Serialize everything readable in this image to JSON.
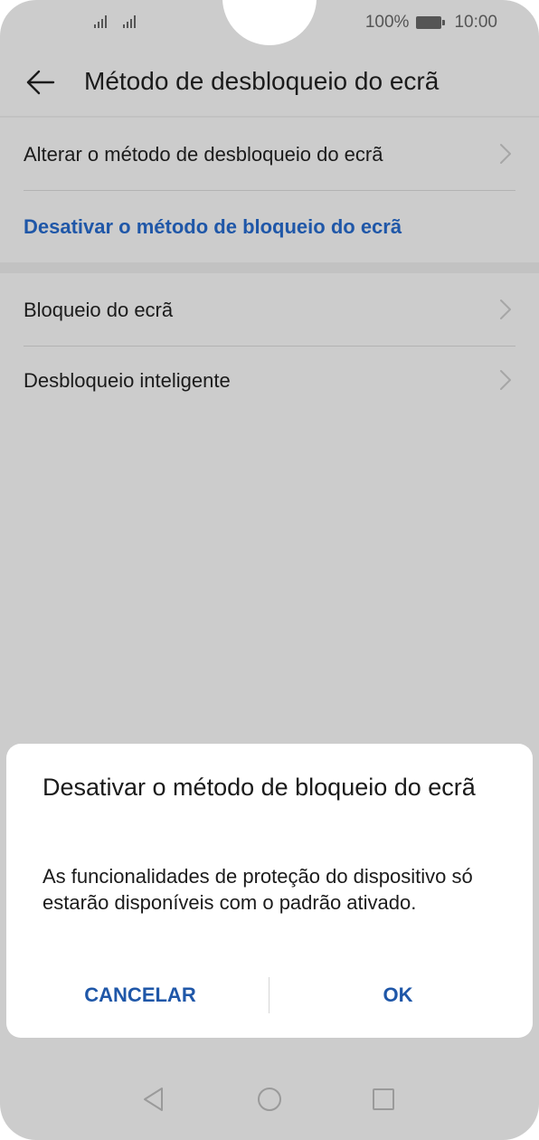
{
  "status_bar": {
    "battery_text": "100%",
    "time": "10:00",
    "icons": [
      "signal-icon",
      "signal-icon",
      "battery-icon"
    ]
  },
  "header": {
    "title": "Método de desbloqueio do ecrã",
    "back_icon": "arrow-left-icon"
  },
  "settings": {
    "change_method": "Alterar o método de desbloqueio do ecrã",
    "disable_method": "Desativar o método de bloqueio do ecrã",
    "screen_lock": "Bloqueio do ecrã",
    "smart_unlock": "Desbloqueio inteligente"
  },
  "dialog": {
    "title": "Desativar o método de bloqueio do ecrã",
    "message": "As funcionalidades de proteção do dispositivo só estarão disponíveis com o padrão ativado.",
    "cancel_label": "CANCELAR",
    "ok_label": "OK"
  },
  "nav_bar": {
    "icons": [
      "nav-back-icon",
      "nav-home-icon",
      "nav-recents-icon"
    ]
  },
  "colors": {
    "accent": "#1f57a8",
    "background_dim": "#cccccc",
    "dialog_bg": "#ffffff"
  }
}
